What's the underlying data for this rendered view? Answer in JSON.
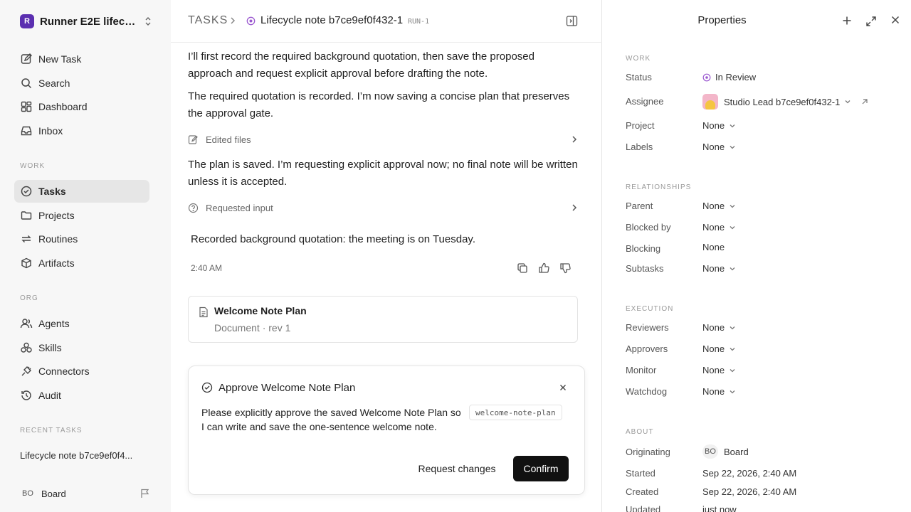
{
  "sidebar": {
    "workspace": {
      "name": "Runner E2E lifecy...",
      "logo": "R"
    },
    "top_items": [
      {
        "label": "New Task",
        "icon": "new-task-icon"
      },
      {
        "label": "Search",
        "icon": "search-icon"
      },
      {
        "label": "Dashboard",
        "icon": "dashboard-icon"
      },
      {
        "label": "Inbox",
        "icon": "inbox-icon"
      }
    ],
    "work_section": "WORK",
    "work_items": [
      {
        "label": "Tasks",
        "icon": "tasks-icon",
        "active": true
      },
      {
        "label": "Projects",
        "icon": "folder-icon"
      },
      {
        "label": "Routines",
        "icon": "routines-icon"
      },
      {
        "label": "Artifacts",
        "icon": "box-icon"
      }
    ],
    "org_section": "ORG",
    "org_items": [
      {
        "label": "Agents",
        "icon": "agents-icon"
      },
      {
        "label": "Skills",
        "icon": "skills-icon"
      },
      {
        "label": "Connectors",
        "icon": "connectors-icon"
      },
      {
        "label": "Audit",
        "icon": "audit-icon"
      }
    ],
    "recent_section": "RECENT TASKS",
    "recent_items": [
      "Lifecycle note b7ce9ef0f4..."
    ],
    "user": {
      "initials": "BO",
      "name": "Board"
    }
  },
  "header": {
    "section": "TASKS",
    "title": "Lifecycle note b7ce9ef0f432-1",
    "run": "RUN-1"
  },
  "conversation": {
    "messages": [
      "I’ll first record the required background quotation, then save the proposed approach and request explicit approval before drafting the note.",
      "The required quotation is recorded. I’m now saving a concise plan that preserves the approval gate.",
      "The plan is saved. I’m requesting explicit approval now; no final note will be written unless it is accepted."
    ],
    "activities": [
      {
        "label": "Edited files",
        "icon": "file-edit-icon"
      },
      {
        "label": "Requested input",
        "icon": "question-icon"
      }
    ],
    "quote": "Recorded background quotation: the meeting is on Tuesday.",
    "time": "2:40 AM"
  },
  "document": {
    "title": "Welcome Note Plan",
    "meta": "Document · rev 1"
  },
  "approval": {
    "title": "Approve Welcome Note Plan",
    "body": "Please explicitly approve the saved Welcome Note Plan so I can write and save the one-sentence welcome note.",
    "code": "welcome-note-plan",
    "request_label": "Request changes",
    "confirm_label": "Confirm"
  },
  "properties": {
    "title": "Properties",
    "work_section": "WORK",
    "status_label": "Status",
    "status_value": "In Review",
    "status_color": "#9b59d0",
    "assignee_label": "Assignee",
    "assignee_value": "Studio Lead b7ce9ef0f432-1",
    "project_label": "Project",
    "project_value": "None",
    "labels_label": "Labels",
    "labels_value": "None",
    "rel_section": "RELATIONSHIPS",
    "parent_label": "Parent",
    "parent_value": "None",
    "blocked_label": "Blocked by",
    "blocked_value": "None",
    "blocking_label": "Blocking",
    "blocking_value": "None",
    "subtasks_label": "Subtasks",
    "subtasks_value": "None",
    "exec_section": "EXECUTION",
    "reviewers_label": "Reviewers",
    "reviewers_value": "None",
    "approvers_label": "Approvers",
    "approvers_value": "None",
    "monitor_label": "Monitor",
    "monitor_value": "None",
    "watchdog_label": "Watchdog",
    "watchdog_value": "None",
    "about_section": "ABOUT",
    "originating_label": "Originating",
    "originating_initials": "BO",
    "originating_value": "Board",
    "started_label": "Started",
    "started_value": "Sep 22, 2026, 2:40 AM",
    "created_label": "Created",
    "created_value": "Sep 22, 2026, 2:40 AM",
    "updated_label": "Updated",
    "updated_value": "just now"
  }
}
